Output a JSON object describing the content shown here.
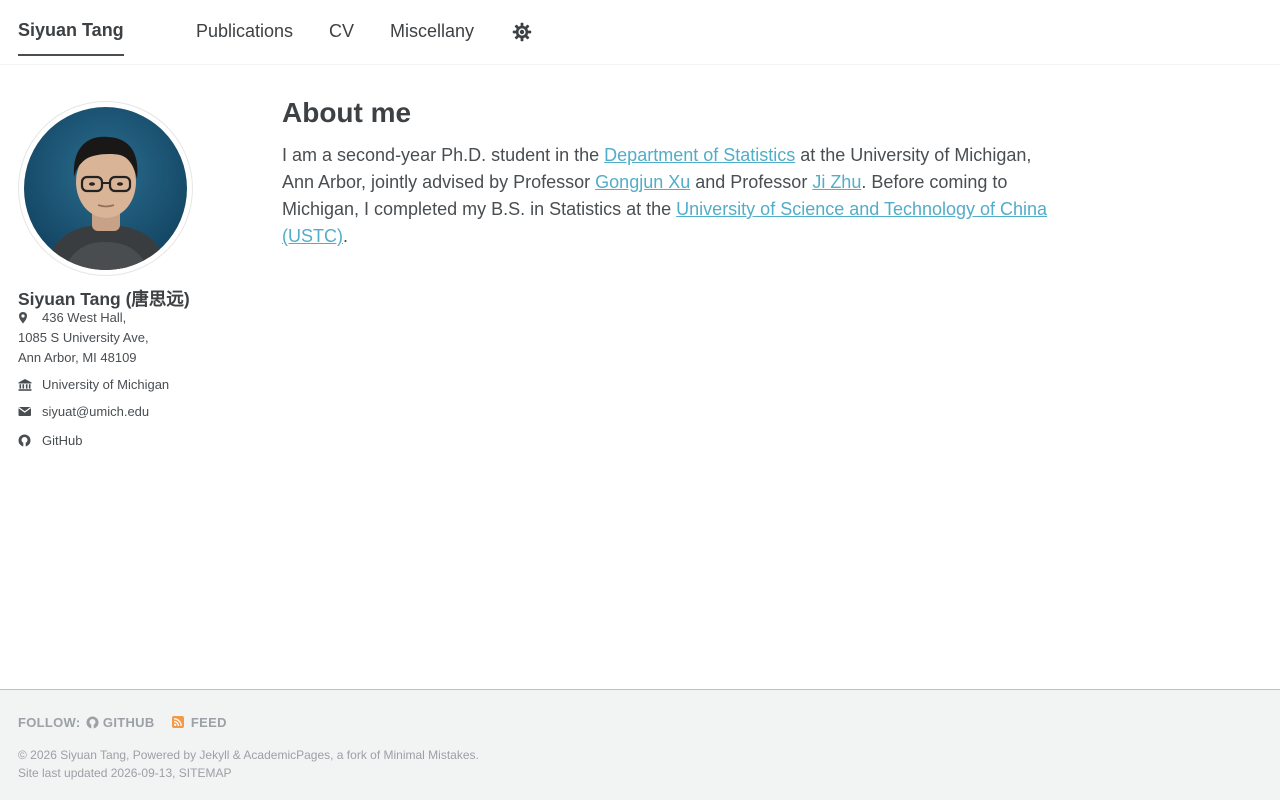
{
  "masthead": {
    "site_title": "Siyuan Tang",
    "nav": [
      "Publications",
      "CV",
      "Miscellany"
    ],
    "theme_icon": "gear-icon"
  },
  "sidebar": {
    "name": "Siyuan Tang (唐思远)",
    "address": [
      "436 West Hall,",
      "1085 S University Ave,",
      "Ann Arbor, MI 48109"
    ],
    "affiliation": "University of Michigan",
    "email": "siyuat@umich.edu",
    "github": "GitHub"
  },
  "main": {
    "title": "About me",
    "about": {
      "t1": "I am a second-year Ph.D. student in the ",
      "link1": "Department of Statistics",
      "t2": " at the University of Michigan, Ann Arbor, jointly advised by Professor ",
      "link2": "Gongjun Xu",
      "t3": " and Professor ",
      "link3": "Ji Zhu",
      "t4": ". Before coming to Michigan, I completed my B.S. in Statistics at the ",
      "link4": "University of Science and Technology of China (USTC)",
      "t5": "."
    }
  },
  "footer": {
    "follow_label": "FOLLOW:",
    "github_label": "GITHUB",
    "feed_label": "FEED",
    "line1": "© 2026 Siyuan Tang, Powered by Jekyll & AcademicPages, a fork of Minimal Mistakes.",
    "line2": "Site last updated 2026-09-13, SITEMAP"
  },
  "colors": {
    "link": "#52adc8",
    "text": "#494e52",
    "footer_bg": "#f2f3f3",
    "feed_icon": "#f2994a"
  }
}
